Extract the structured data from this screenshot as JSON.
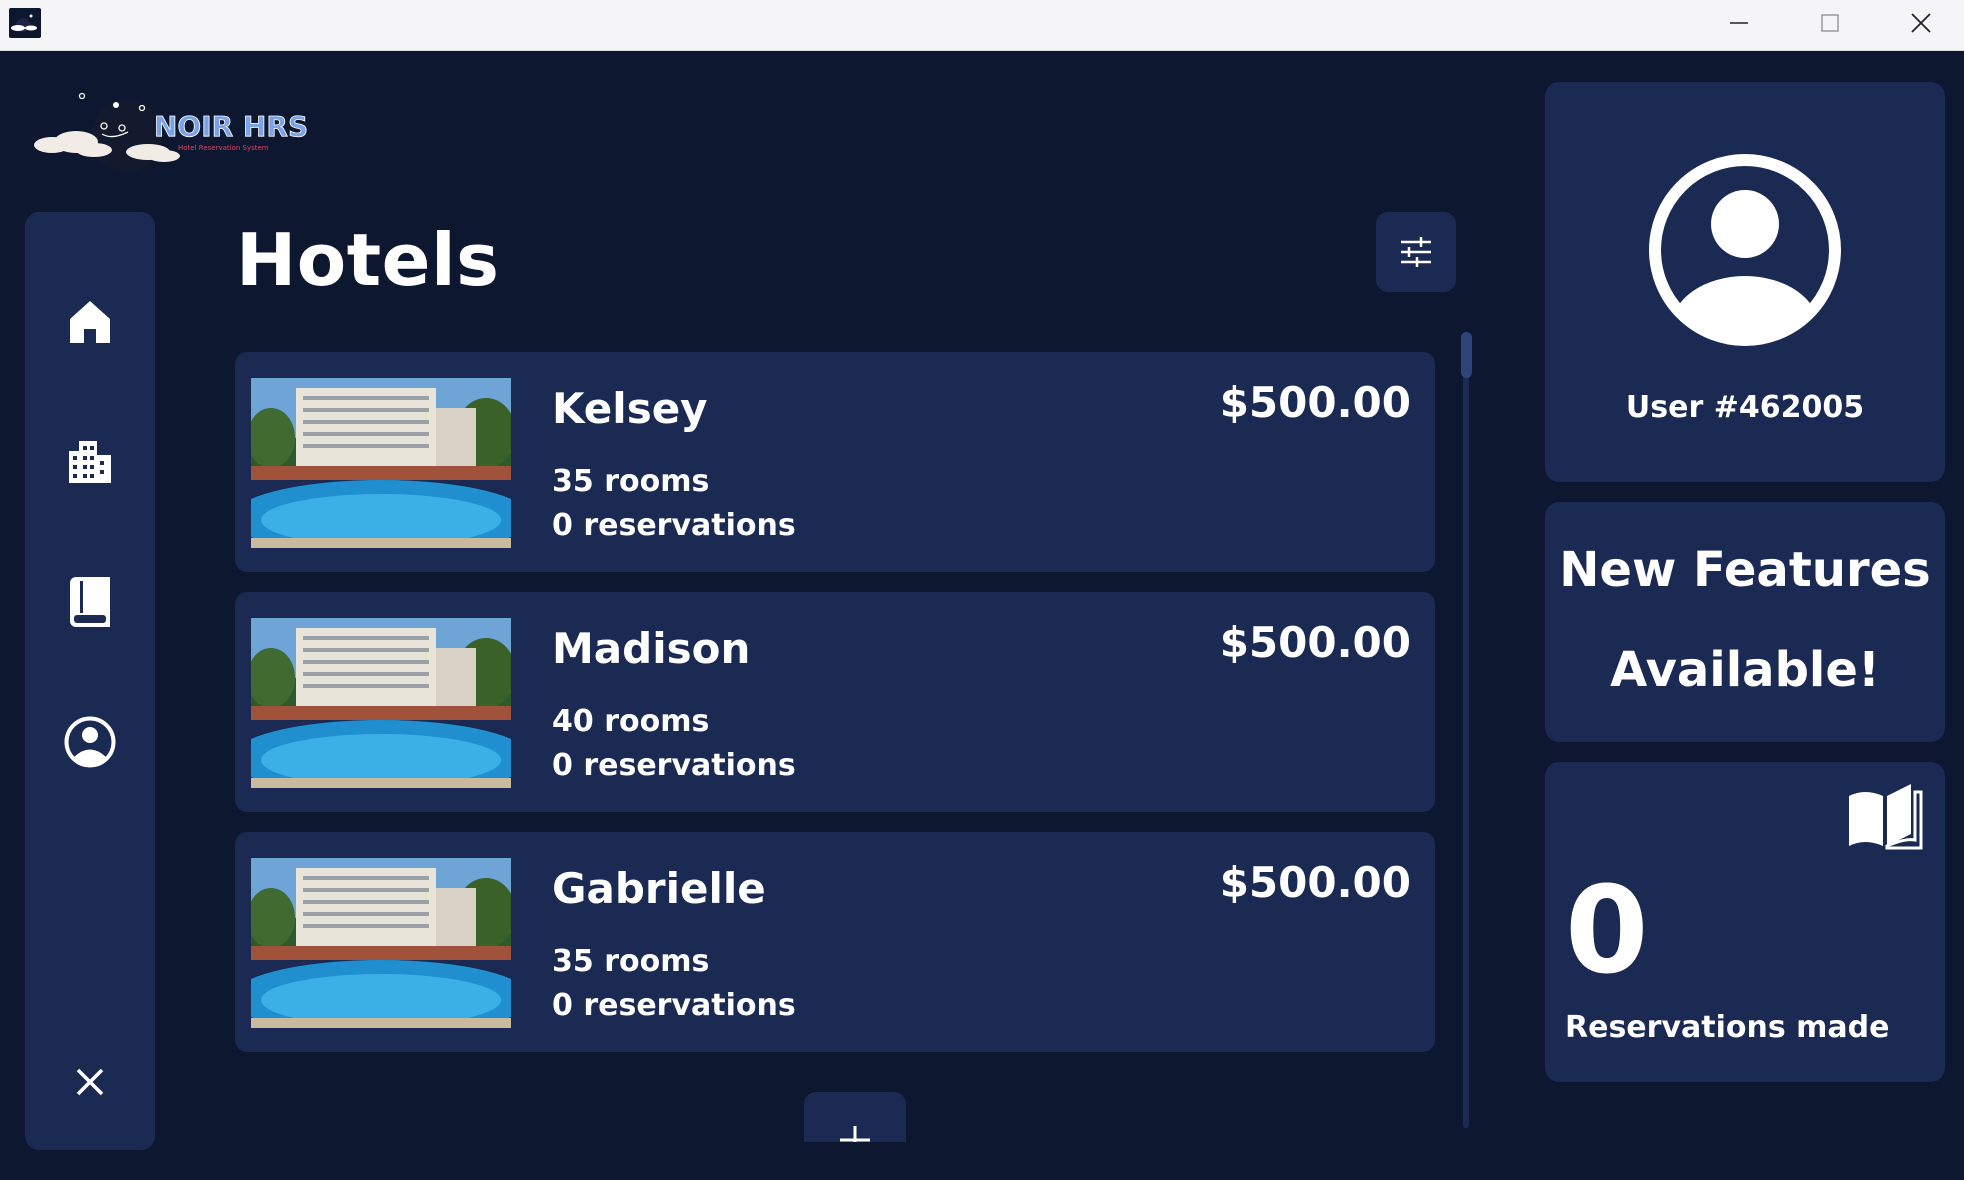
{
  "window": {
    "icons": {
      "app": "app-icon",
      "minimize": "minimize-icon",
      "maximize": "maximize-icon",
      "close": "close-icon"
    }
  },
  "logo": {
    "title": "NOIR HRS",
    "subtitle": "Hotel Reservation System"
  },
  "sidebar": {
    "items": [
      {
        "name": "home",
        "icon": "home-icon"
      },
      {
        "name": "hotels",
        "icon": "building-icon"
      },
      {
        "name": "reservations",
        "icon": "book-icon"
      },
      {
        "name": "profile",
        "icon": "user-circle-icon"
      }
    ],
    "exit_icon": "close-icon"
  },
  "main": {
    "title": "Hotels",
    "filter_icon": "sliders-icon",
    "hotels": [
      {
        "name": "Kelsey",
        "price": "$500.00",
        "rooms": "35 rooms",
        "reservations": "0 reservations"
      },
      {
        "name": "Madison",
        "price": "$500.00",
        "rooms": "40 rooms",
        "reservations": "0 reservations"
      },
      {
        "name": "Gabrielle",
        "price": "$500.00",
        "rooms": "35 rooms",
        "reservations": "0 reservations"
      }
    ],
    "add_icon": "plus-icon"
  },
  "profile": {
    "user_label": "User #462005",
    "avatar_icon": "user-avatar-icon"
  },
  "features": {
    "line1": "New Features",
    "line2": "Available!"
  },
  "reservations": {
    "count": "0",
    "label": "Reservations made",
    "icon": "open-book-icon"
  },
  "colors": {
    "background": "#0d1730",
    "card": "#1b2a52",
    "text": "#ffffff",
    "logo_accent": "#7aa2e8"
  }
}
